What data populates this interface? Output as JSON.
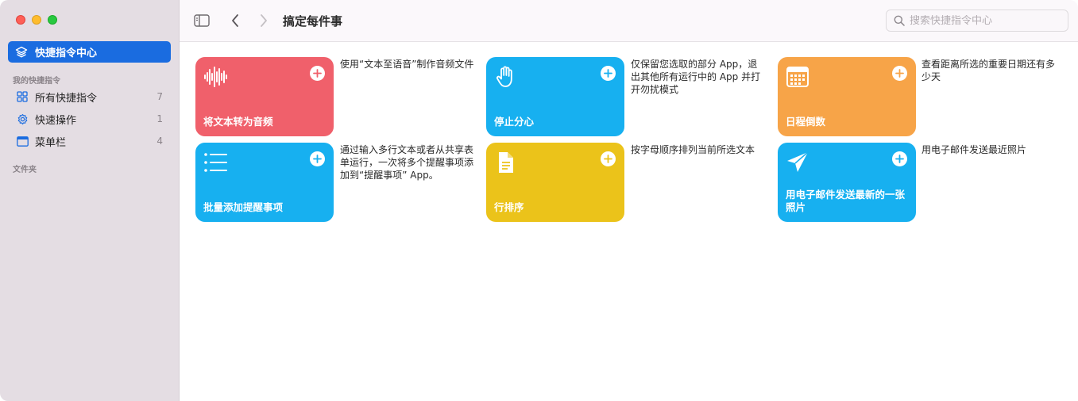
{
  "sidebar": {
    "gallery_label": "快捷指令中心",
    "section_my": "我的快捷指令",
    "items": [
      {
        "label": "所有快捷指令",
        "count": "7"
      },
      {
        "label": "快速操作",
        "count": "1"
      },
      {
        "label": "菜单栏",
        "count": "4"
      }
    ],
    "section_folders": "文件夹"
  },
  "toolbar": {
    "title": "搞定每件事",
    "search_placeholder": "搜索快捷指令中心"
  },
  "cards": [
    {
      "title": "将文本转为音频",
      "description": "使用“文本至语音”制作音频文件",
      "color": "#f0606b",
      "icon": "waveform-icon"
    },
    {
      "title": "停止分心",
      "description": "仅保留您选取的部分 App，退出其他所有运行中的 App 并打开勿扰模式",
      "color": "#17b0f0",
      "icon": "hand-icon"
    },
    {
      "title": "日程倒数",
      "description": "查看距离所选的重要日期还有多少天",
      "color": "#f7a448",
      "icon": "calendar-icon"
    },
    {
      "title": "批量添加提醒事项",
      "description": "通过输入多行文本或者从共享表单运行，一次将多个提醒事项添加到“提醒事项” App。",
      "color": "#17b0f0",
      "icon": "list-icon"
    },
    {
      "title": "行排序",
      "description": "按字母顺序排列当前所选文本",
      "color": "#ebc31a",
      "icon": "document-icon"
    },
    {
      "title": "用电子邮件发送最新的一张照片",
      "description": "用电子邮件发送最近照片",
      "color": "#17b0f0",
      "icon": "paperplane-icon"
    }
  ]
}
